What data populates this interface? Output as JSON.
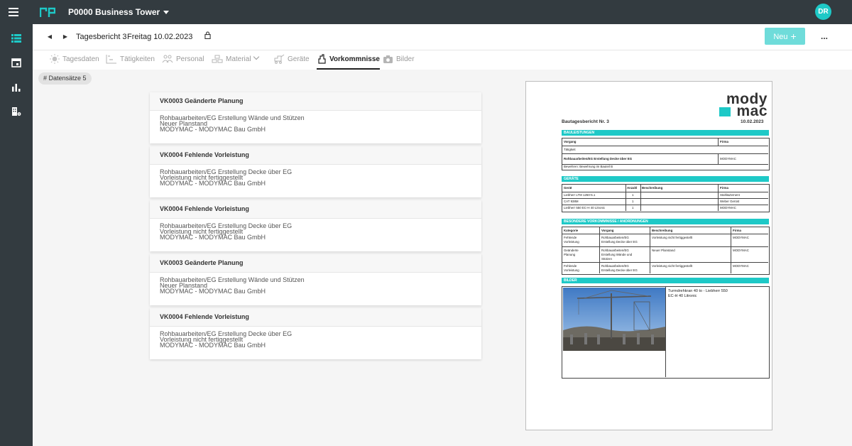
{
  "app": {
    "project_title": "P0000 Business Tower",
    "avatar_initials": "DR",
    "accent_color": "#1ec9c7"
  },
  "report": {
    "title": "Tagesbericht 3",
    "date": "Freitag 10.02.2023",
    "new_button": "Neu",
    "more": "..."
  },
  "tabs": [
    {
      "label": "Tagesdaten",
      "icon": "sun-icon"
    },
    {
      "label": "Tätigkeiten",
      "icon": "activity-icon"
    },
    {
      "label": "Personal",
      "icon": "people-icon"
    },
    {
      "label": "Material",
      "icon": "material-icon"
    },
    {
      "label": "Geräte",
      "icon": "machine-icon"
    },
    {
      "label": "Vorkommnisse",
      "icon": "incident-icon",
      "active": true
    },
    {
      "label": "Bilder",
      "icon": "camera-icon"
    }
  ],
  "chip": "# Datensätze 5",
  "incidents": [
    {
      "title": "VK0003 Geänderte Planung",
      "line1": "Rohbauarbeiten/EG Erstellung Wände und Stützen",
      "line2": "Neuer Planstand",
      "line3": "MODYMAC - MODYMAC Bau GmbH"
    },
    {
      "title": "VK0004 Fehlende Vorleistung",
      "line1": "Rohbauarbeiten/EG Erstellung Decke über EG",
      "line2": "Vorleistung nicht fertiggestellt",
      "line3": "MODYMAC - MODYMAC Bau GmbH"
    },
    {
      "title": "VK0004 Fehlende Vorleistung",
      "line1": "Rohbauarbeiten/EG Erstellung Decke über EG",
      "line2": "Vorleistung nicht fertiggestellt",
      "line3": "MODYMAC - MODYMAC Bau GmbH"
    },
    {
      "title": "VK0003 Geänderte Planung",
      "line1": "Rohbauarbeiten/EG Erstellung Wände und Stützen",
      "line2": "Neuer Planstand",
      "line3": "MODYMAC - MODYMAC Bau GmbH"
    },
    {
      "title": "VK0004 Fehlende Vorleistung",
      "line1": "Rohbauarbeiten/EG Erstellung Decke über EG",
      "line2": "Vorleistung nicht fertiggestellt",
      "line3": "MODYMAC - MODYMAC Bau GmbH"
    }
  ],
  "preview": {
    "logo_top": "mody",
    "logo_bottom": "mac",
    "doc_title": "Bautagesbericht Nr. 3",
    "doc_date": "10.02.2023",
    "sec_bau": "BAULEISTUNGEN",
    "bau_head": {
      "vorgang": "Vorgang",
      "firma": "Firma"
    },
    "bau_taetigkeit": "Tätigkeit",
    "bau_row": {
      "vorgang": "Rohbauarbeiten/EG Erstellung Decke über EG",
      "firma": "MODYMAC"
    },
    "bau_note": "Bewehren: Bewehrung im Bauteil B",
    "sec_geraete": "GERÄTE",
    "ger_head": {
      "geraet": "Gerät",
      "anzahl": "Anzahl",
      "beschreibung": "Beschreibung",
      "firma": "Firma"
    },
    "ger_rows": [
      {
        "geraet": "Liebherr LTM 1250-5.1",
        "anzahl": "1",
        "firma": "Stahl&Zement"
      },
      {
        "geraet": "CAT 938M",
        "anzahl": "1",
        "firma": "Weber Gerüst"
      },
      {
        "geraet": "Liebherr 550 EC-H 40 Litronic",
        "anzahl": "1",
        "firma": "MODYMAC"
      }
    ],
    "sec_vork": "BESONDERE VORKOMMNISSE / ANORDNUNGEN",
    "vork_head": {
      "kategorie": "Kategorie",
      "vorgang": "Vorgang",
      "beschreibung": "Beschreibung",
      "firma": "Firma"
    },
    "vork_rows": [
      {
        "kat1": "Fehlende",
        "kat2": "Vorleistung",
        "vg1": "Rohbauarbeiten/EG",
        "vg2": "Erstellung Decke über EG",
        "vg3": "",
        "besch": "Vorleistung nicht fertiggestellt",
        "firma": "MODYMAC"
      },
      {
        "kat1": "Geänderte",
        "kat2": "Planung",
        "vg1": "Rohbauarbeiten/EG",
        "vg2": "Erstellung Wände und",
        "vg3": "Stützen",
        "besch": "Neuer Planstand",
        "firma": "MODYMAC"
      },
      {
        "kat1": "Fehlende",
        "kat2": "Vorleistung",
        "vg1": "Rohbauarbeiten/EG",
        "vg2": "Erstellung Decke über EG",
        "vg3": "",
        "besch": "Vorleistung nicht fertiggestellt",
        "firma": "MODYMAC"
      }
    ],
    "sec_bilder": "BILDER",
    "bild_caption1": "Turmdrehkran 40 to - Liebherr 550",
    "bild_caption2": "EC-H 40 Litronic"
  }
}
